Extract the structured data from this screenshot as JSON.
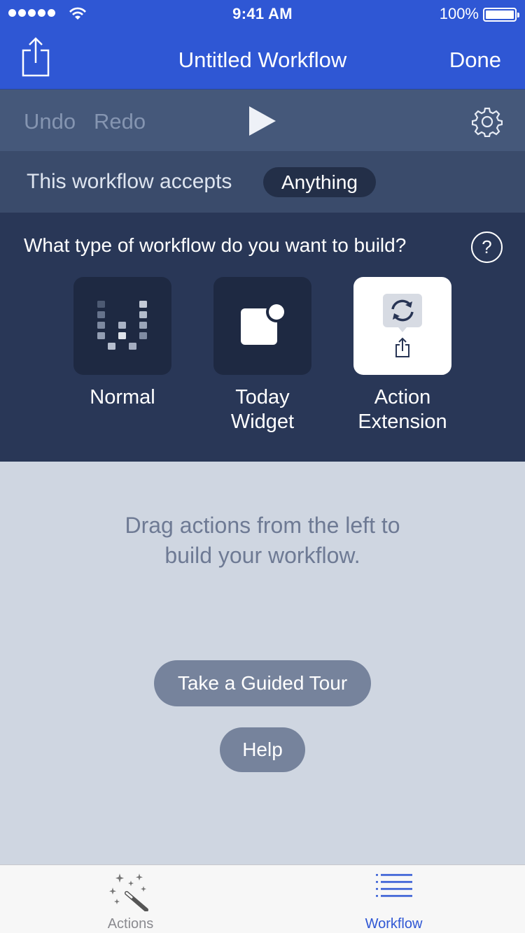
{
  "status_bar": {
    "time": "9:41 AM",
    "battery_percent": "100%",
    "signal_icon": "signal-dots-icon",
    "wifi_icon": "wifi-icon",
    "battery_icon": "battery-icon",
    "battery_level": 1.0
  },
  "nav": {
    "title": "Untitled Workflow",
    "done_label": "Done",
    "share_icon": "share-icon"
  },
  "toolbar": {
    "undo_label": "Undo",
    "redo_label": "Redo",
    "play_icon": "play-icon",
    "settings_icon": "gear-icon"
  },
  "accepts": {
    "label": "This workflow accepts",
    "value": "Anything"
  },
  "workflow_type": {
    "question": "What type of workflow do you want to build?",
    "help_icon": "question-circle-icon",
    "help_glyph": "?",
    "options": [
      {
        "label_line1": "Normal",
        "label_line2": "",
        "icon": "workflow-logo-icon",
        "selected": false
      },
      {
        "label_line1": "Today",
        "label_line2": "Widget",
        "icon": "today-widget-icon",
        "selected": false
      },
      {
        "label_line1": "Action",
        "label_line2": "Extension",
        "icon": "action-extension-icon",
        "selected": true
      }
    ]
  },
  "canvas": {
    "hint_line1": "Drag actions from the left to",
    "hint_line2": "build your workflow.",
    "tour_label": "Take a Guided Tour",
    "help_label": "Help"
  },
  "tabs": [
    {
      "label": "Actions",
      "icon": "magic-wand-icon",
      "active": false
    },
    {
      "label": "Workflow",
      "icon": "list-icon",
      "active": true
    }
  ],
  "colors": {
    "nav_blue": "#2f57d4",
    "toolbar": "#45587a",
    "accepts_row": "#3a4b6b",
    "type_panel": "#293757",
    "tile": "#1e2942",
    "canvas": "#cfd6e1",
    "button_gray": "#76839c",
    "active_tab": "#2f57d4"
  }
}
